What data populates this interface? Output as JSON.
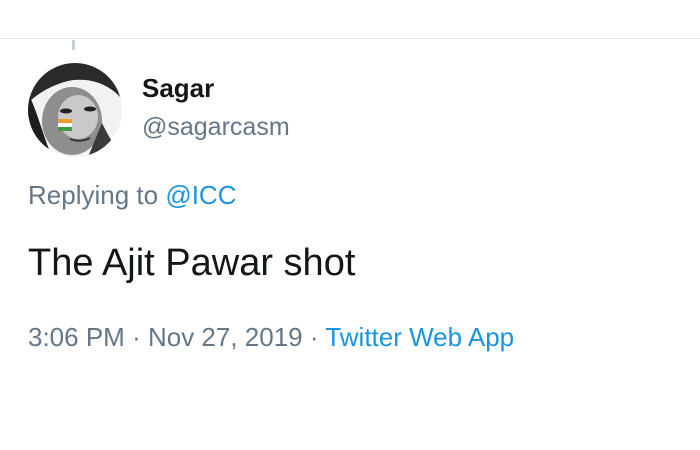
{
  "tweet": {
    "author_name": "Sagar",
    "author_handle": "@sagarcasm",
    "replying_prefix": "Replying to",
    "replying_to": "@ICC",
    "text": "The Ajit Pawar shot",
    "time": "3:06 PM",
    "separator": "·",
    "date": "Nov 27, 2019",
    "source": "Twitter Web App"
  },
  "colors": {
    "primary_text": "#14171a",
    "secondary_text": "#657786",
    "link": "#1b95e0",
    "divider": "#e3e7ea"
  },
  "icons": {
    "avatar": "profile-photo"
  }
}
